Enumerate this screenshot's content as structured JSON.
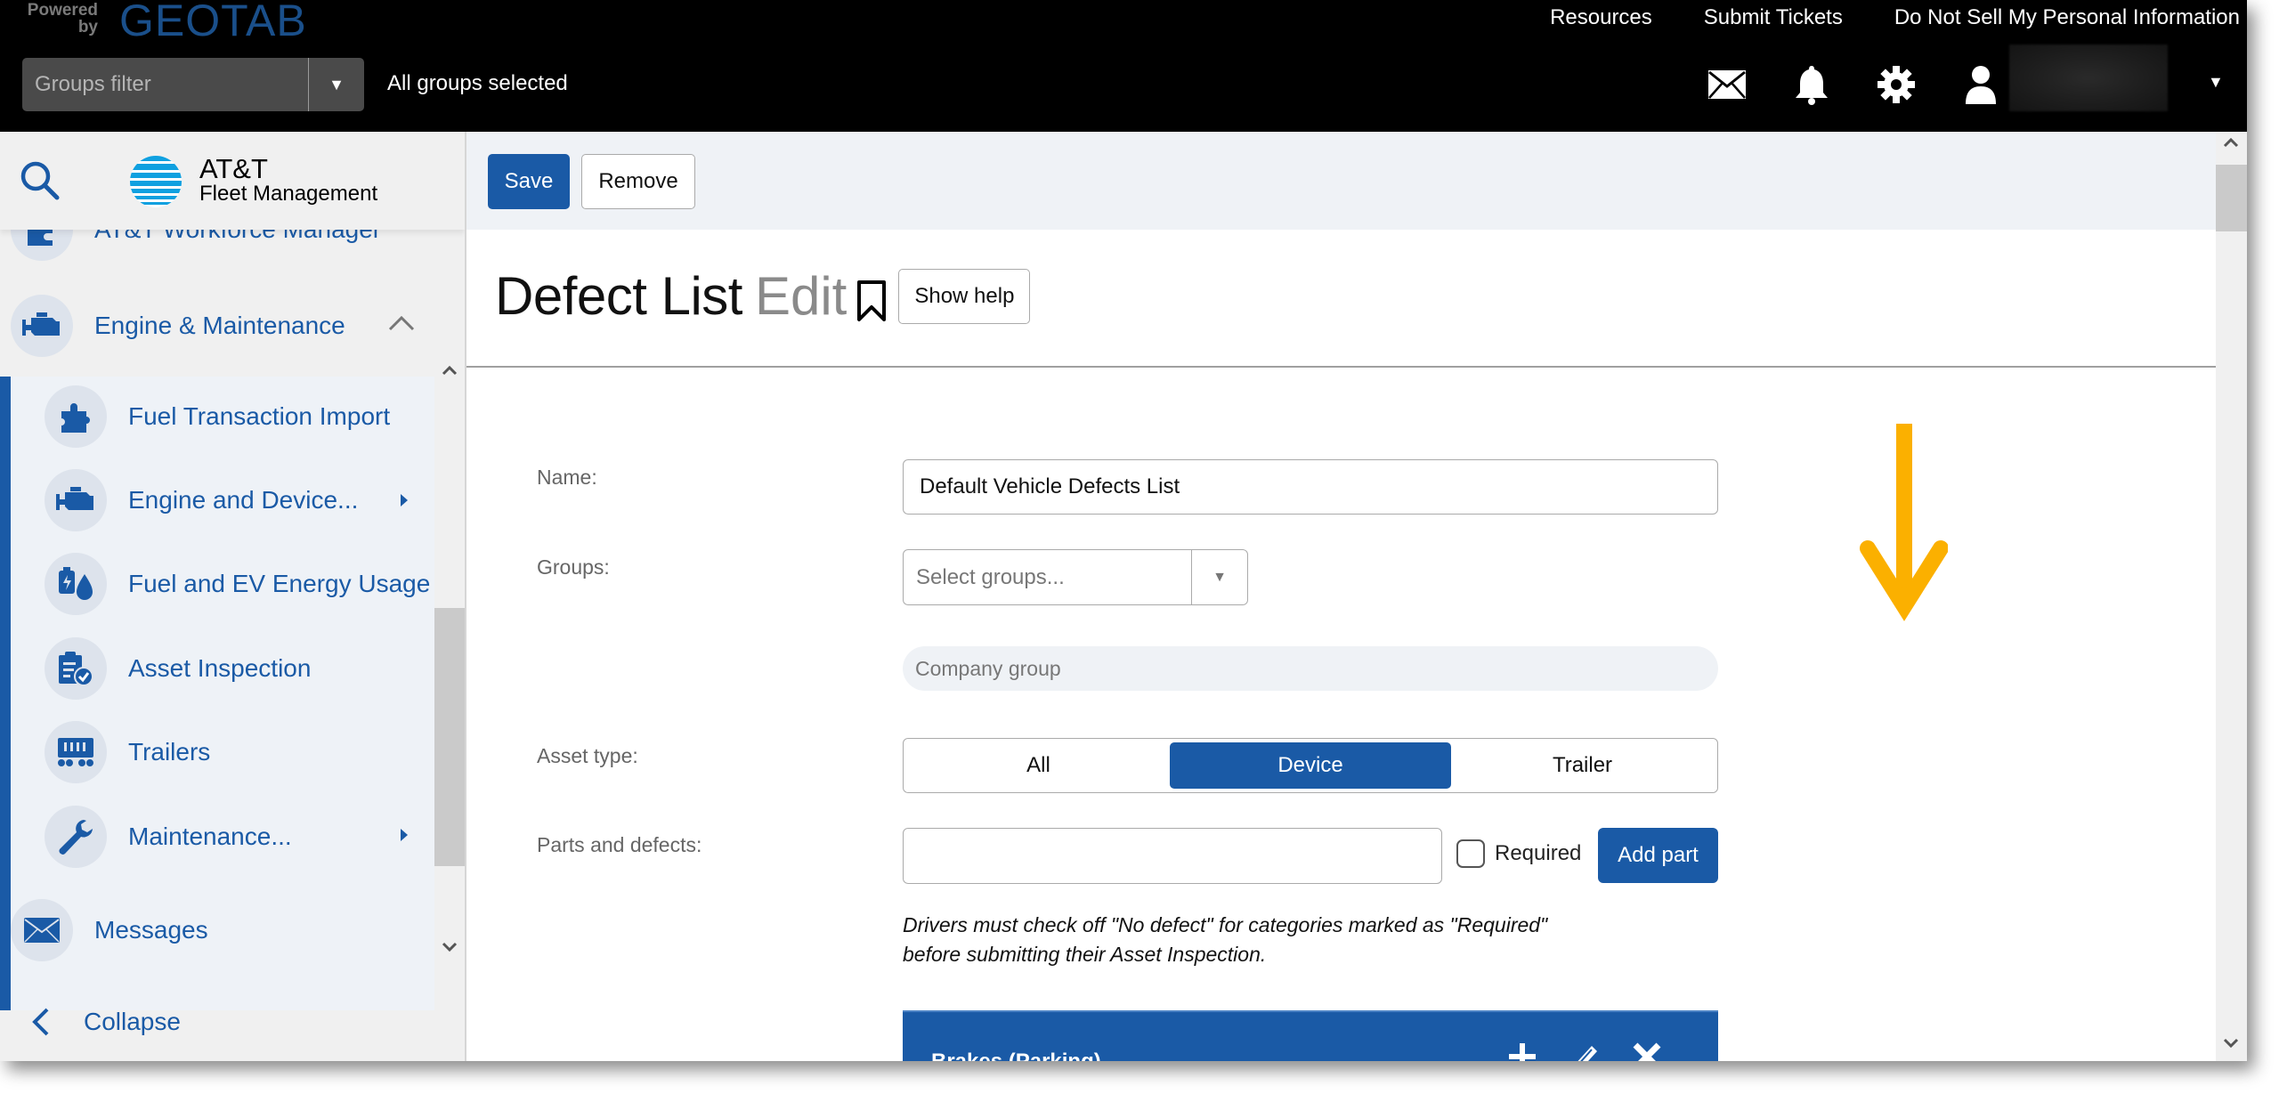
{
  "topbar": {
    "powered_by": "Powered by",
    "brand": "GEOTAB",
    "links": [
      "Resources",
      "Submit Tickets",
      "Do Not Sell My Personal Information"
    ],
    "groups_filter_placeholder": "Groups filter",
    "groups_status": "All groups selected",
    "icons": [
      "mail-icon",
      "bell-icon",
      "gear-icon",
      "user-icon"
    ]
  },
  "sidebar": {
    "logo_name": "AT&T",
    "logo_sub": "Fleet Management",
    "partial_item": "AT&T Workforce Manager",
    "section": {
      "label": "Engine & Maintenance",
      "expanded": true
    },
    "sub_items": [
      {
        "label": "Fuel Transaction Import",
        "icon": "puzzle-icon",
        "has_submenu": false
      },
      {
        "label": "Engine and Device...",
        "icon": "engine-icon",
        "has_submenu": true
      },
      {
        "label": "Fuel and EV Energy Usage",
        "icon": "fuel-ev-icon",
        "has_submenu": false
      },
      {
        "label": "Asset Inspection",
        "icon": "clipboard-check-icon",
        "has_submenu": false
      },
      {
        "label": "Trailers",
        "icon": "trailer-icon",
        "has_submenu": false
      },
      {
        "label": "Maintenance...",
        "icon": "wrench-icon",
        "has_submenu": true
      }
    ],
    "messages": "Messages",
    "collapse": "Collapse"
  },
  "toolbar": {
    "save": "Save",
    "remove": "Remove"
  },
  "page": {
    "title": "Defect List",
    "mode": "Edit",
    "show_help": "Show help"
  },
  "form": {
    "name_label": "Name:",
    "name_value": "Default Vehicle Defects List",
    "groups_label": "Groups:",
    "groups_placeholder": "Select groups...",
    "company_group": "Company group",
    "asset_type_label": "Asset type:",
    "asset_types": [
      "All",
      "Device",
      "Trailer"
    ],
    "asset_type_selected": "Device",
    "parts_label": "Parts and defects:",
    "parts_value": "",
    "required_label": "Required",
    "required_checked": false,
    "add_part": "Add part",
    "hint_line1": "Drivers must check off \"No defect\" for categories marked as \"Required\"",
    "hint_line2": "before submitting their Asset Inspection."
  },
  "categories": [
    {
      "name": "Brakes (Parking)"
    }
  ],
  "colors": {
    "brand_blue": "#1a5aa6",
    "annotation_arrow": "#fbb000",
    "topbar_bg": "#000000"
  }
}
